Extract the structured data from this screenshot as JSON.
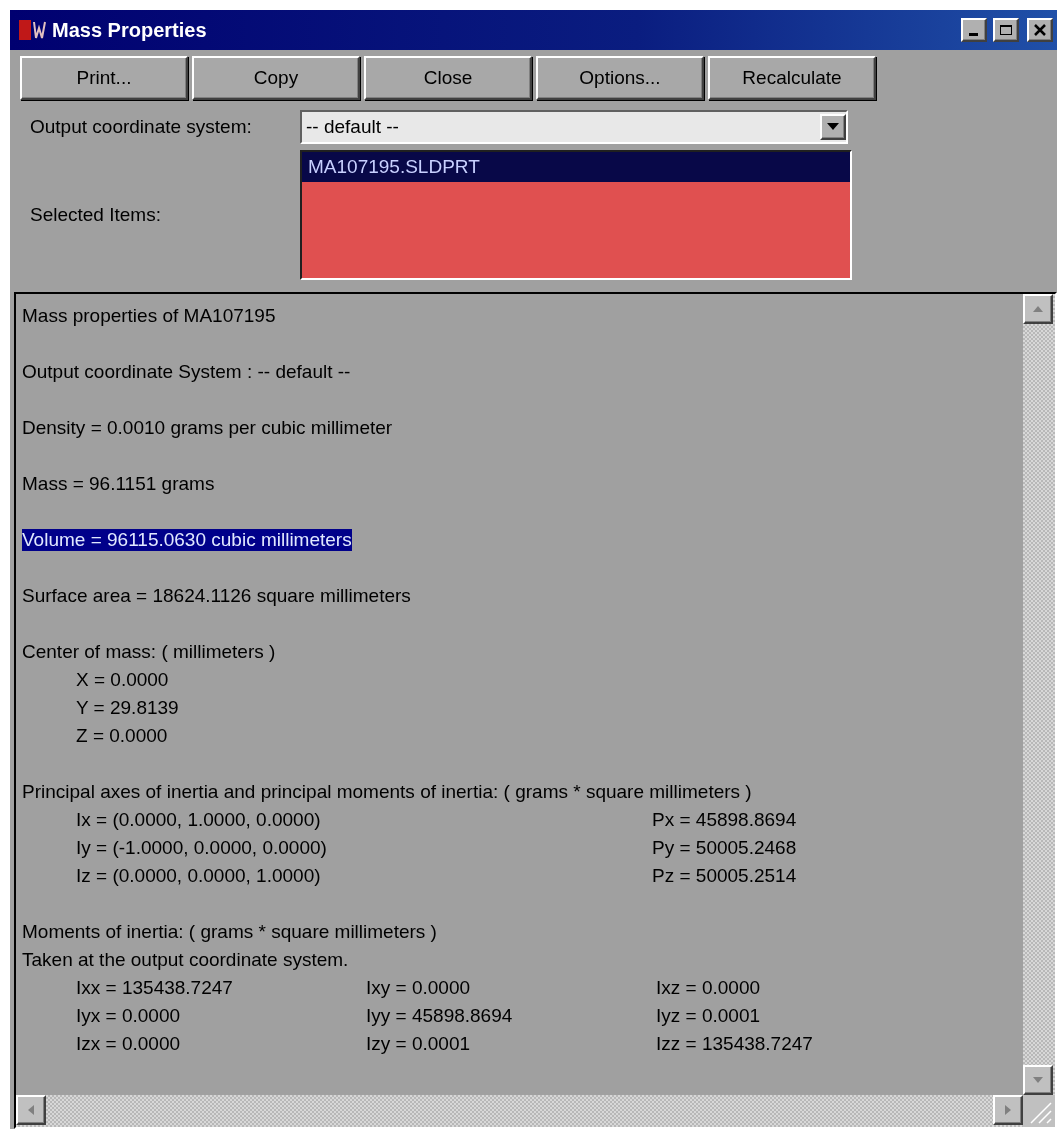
{
  "window": {
    "title": "Mass Properties"
  },
  "buttons": [
    {
      "label": "Print..."
    },
    {
      "label": "Copy"
    },
    {
      "label": "Close"
    },
    {
      "label": "Options..."
    },
    {
      "label": "Recalculate"
    }
  ],
  "coordinate_system": {
    "label": "Output coordinate system:",
    "value": "-- default --"
  },
  "selected_items": {
    "label": "Selected Items:",
    "items": [
      {
        "text": "MA107195.SLDPRT",
        "selected": true
      }
    ]
  },
  "report": {
    "paragraphs": [
      {
        "rows": [
          {
            "kind": "text",
            "text": "Mass properties of MA107195",
            "selected": false
          }
        ]
      },
      {
        "rows": [
          {
            "kind": "text",
            "text": "Output  coordinate System : -- default --",
            "selected": false
          }
        ]
      },
      {
        "rows": [
          {
            "kind": "text",
            "text": "Density = 0.0010 grams per cubic millimeter",
            "selected": false
          }
        ]
      },
      {
        "rows": [
          {
            "kind": "text",
            "text": "Mass = 96.1151 grams",
            "selected": false
          }
        ]
      },
      {
        "rows": [
          {
            "kind": "text",
            "text": "Volume = 96115.0630 cubic millimeters",
            "selected": true
          }
        ]
      },
      {
        "rows": [
          {
            "kind": "text",
            "text": "Surface area = 18624.1126 square millimeters",
            "selected": false
          }
        ]
      },
      {
        "rows": [
          {
            "kind": "text",
            "text": "Center of mass: ( millimeters )",
            "selected": false
          },
          {
            "kind": "columns",
            "cells": [
              "X = 0.0000"
            ]
          },
          {
            "kind": "columns",
            "cells": [
              "Y = 29.8139"
            ]
          },
          {
            "kind": "columns",
            "cells": [
              "Z = 0.0000"
            ]
          }
        ]
      },
      {
        "rows": [
          {
            "kind": "text",
            "text": "Principal axes of inertia and principal moments of inertia: ( grams *  square millimeters )",
            "selected": false
          },
          {
            "kind": "axes",
            "cells": [
              "Ix = (0.0000, 1.0000, 0.0000)",
              "Px = 45898.8694"
            ]
          },
          {
            "kind": "axes",
            "cells": [
              "Iy = (-1.0000, 0.0000, 0.0000)",
              "Py = 50005.2468"
            ]
          },
          {
            "kind": "axes",
            "cells": [
              "Iz = (0.0000, 0.0000, 1.0000)",
              "Pz = 50005.2514"
            ]
          }
        ]
      },
      {
        "rows": [
          {
            "kind": "text",
            "text": "Moments of inertia: ( grams *  square millimeters )",
            "selected": false
          },
          {
            "kind": "text",
            "text": "Taken at the output coordinate system.",
            "selected": false
          },
          {
            "kind": "columns",
            "cells": [
              "Ixx = 135438.7247",
              "Ixy = 0.0000",
              "Ixz = 0.0000"
            ]
          },
          {
            "kind": "columns",
            "cells": [
              "Iyx = 0.0000",
              "Iyy = 45898.8694",
              "Iyz = 0.0001"
            ]
          },
          {
            "kind": "columns",
            "cells": [
              "Izx = 0.0000",
              "Izy = 0.0001",
              "Izz = 135438.7247"
            ]
          }
        ]
      }
    ]
  }
}
